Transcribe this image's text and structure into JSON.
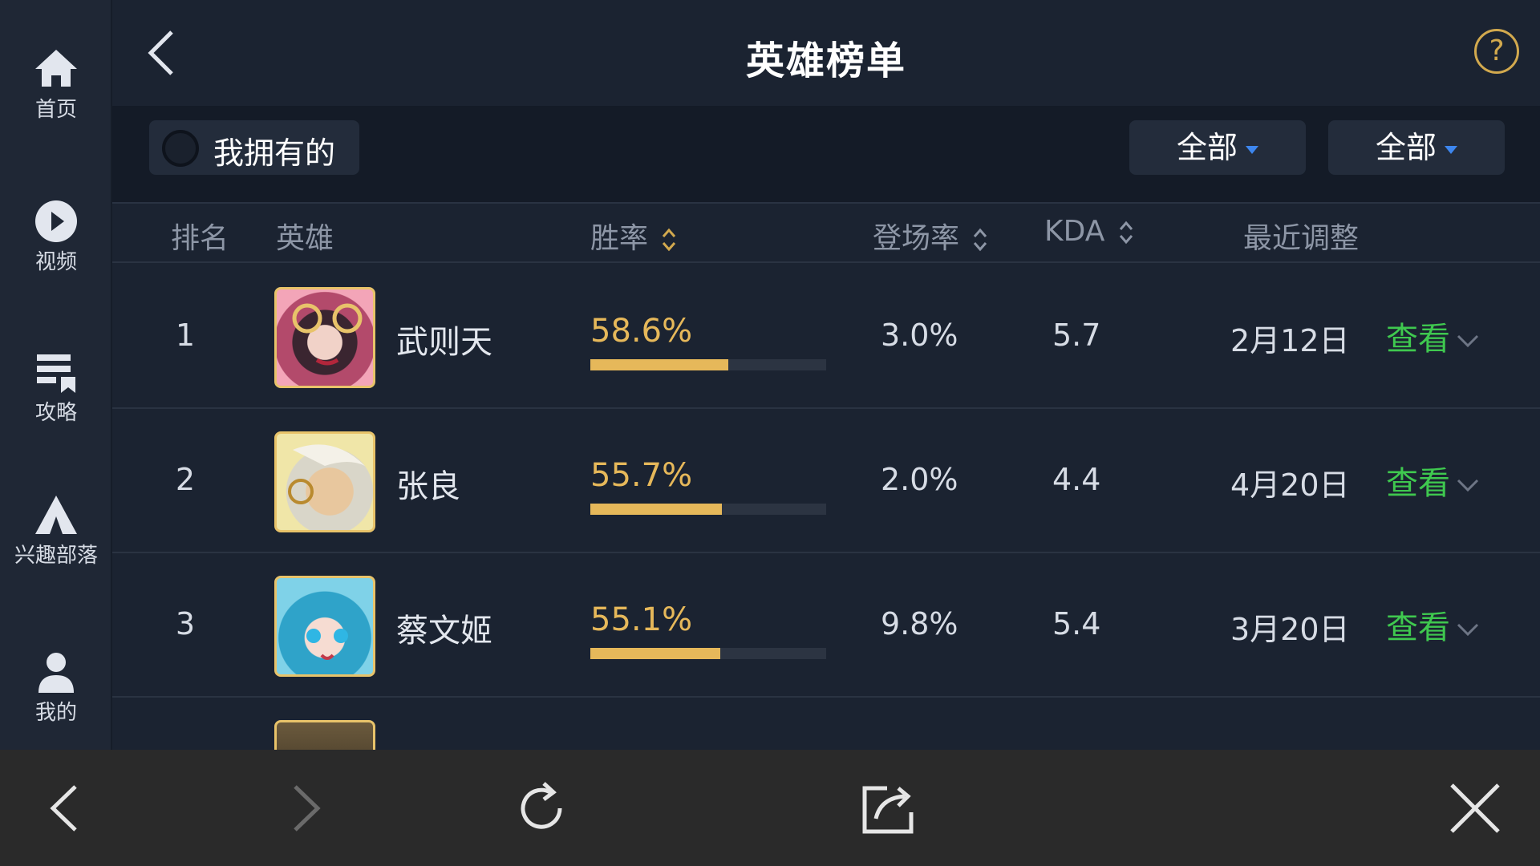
{
  "title": "英雄榜单",
  "sidebar": {
    "items": [
      {
        "label": "首页",
        "icon": "home-icon"
      },
      {
        "label": "视频",
        "icon": "play-icon"
      },
      {
        "label": "攻略",
        "icon": "guide-icon"
      },
      {
        "label": "兴趣部落",
        "icon": "tribe-icon"
      },
      {
        "label": "我的",
        "icon": "user-icon"
      }
    ]
  },
  "header": {
    "help_label": "?"
  },
  "filters": {
    "owned_label": "我拥有的",
    "owned_checked": false,
    "dropdown1": "全部",
    "dropdown2": "全部"
  },
  "table": {
    "headers": {
      "rank": "排名",
      "hero": "英雄",
      "winrate": "胜率",
      "appearance": "登场率",
      "kda": "KDA",
      "recent": "最近调整"
    },
    "rows": [
      {
        "rank": "1",
        "name": "武则天",
        "winrate": "58.6%",
        "winrate_value": 58.6,
        "appearance": "3.0%",
        "kda": "5.7",
        "date": "2月12日",
        "view": "查看"
      },
      {
        "rank": "2",
        "name": "张良",
        "winrate": "55.7%",
        "winrate_value": 55.7,
        "appearance": "2.0%",
        "kda": "4.4",
        "date": "4月20日",
        "view": "查看"
      },
      {
        "rank": "3",
        "name": "蔡文姬",
        "winrate": "55.1%",
        "winrate_value": 55.1,
        "appearance": "9.8%",
        "kda": "5.4",
        "date": "3月20日",
        "view": "查看"
      }
    ]
  },
  "colors": {
    "accent_gold": "#e6b85a",
    "link_green": "#3fc84f",
    "caret_blue": "#3d86ee"
  },
  "bottom_bar": {
    "icons": [
      "back-icon",
      "forward-icon",
      "refresh-icon",
      "share-icon",
      "close-icon"
    ]
  }
}
